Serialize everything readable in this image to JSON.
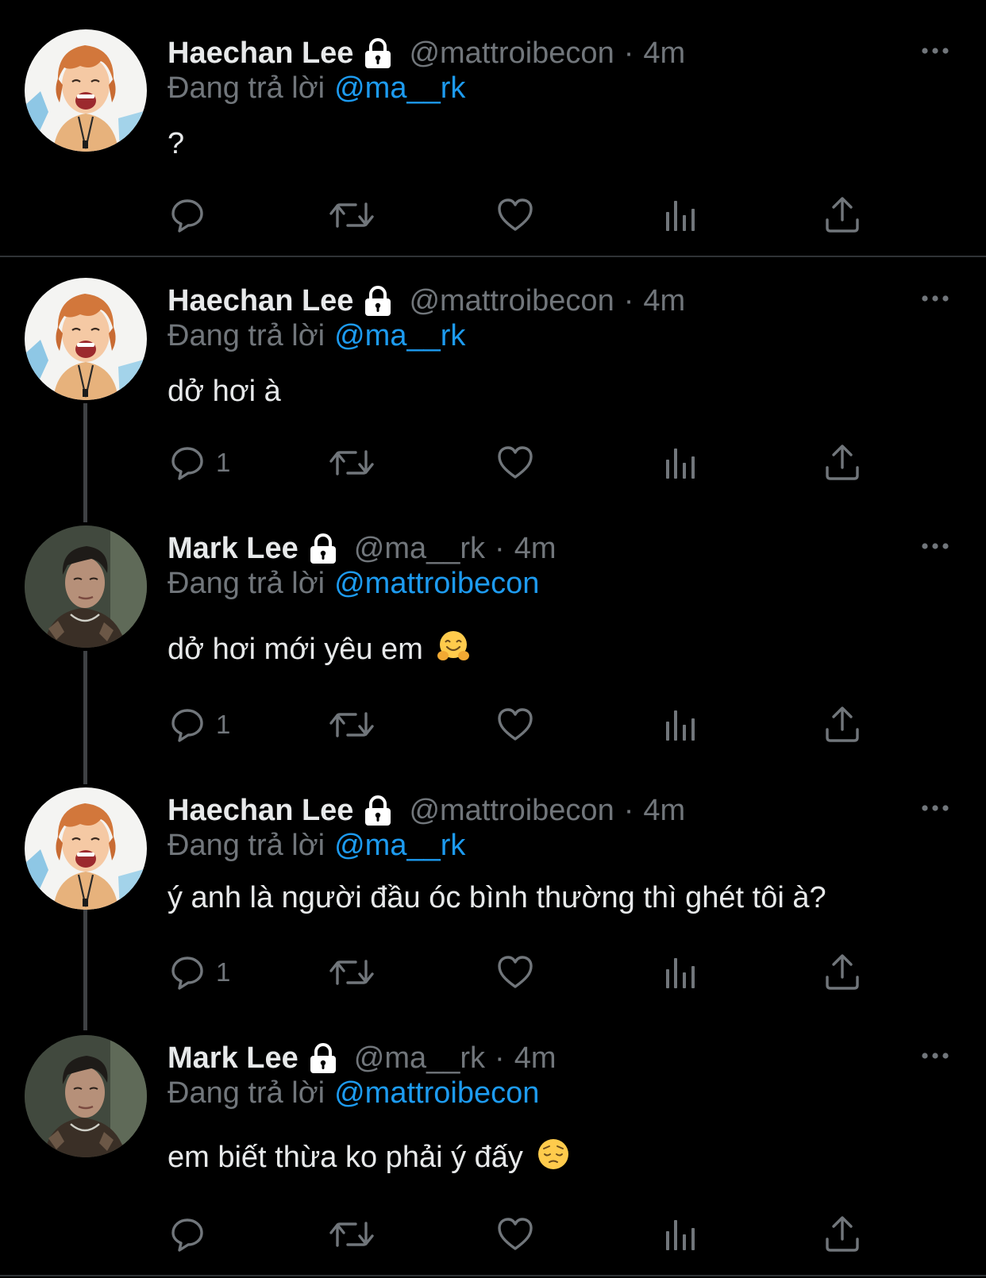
{
  "colors": {
    "background": "#000000",
    "text_primary": "#e7e9ea",
    "text_secondary": "#71767b",
    "mention": "#1d9bf0",
    "thread_line": "#3e4144",
    "divider": "#2f3336"
  },
  "reply_prefix": "Đang trả lời",
  "tweets": [
    {
      "name": "Haechan Lee",
      "handle": "@mattroibecon",
      "separator": "·",
      "time": "4m",
      "reply_to": "@ma__rk",
      "text": "?",
      "emoji": "",
      "reply_count": ""
    },
    {
      "name": "Haechan Lee",
      "handle": "@mattroibecon",
      "separator": "·",
      "time": "4m",
      "reply_to": "@ma__rk",
      "text": "dở hơi à",
      "emoji": "",
      "reply_count": "1"
    },
    {
      "name": "Mark Lee",
      "handle": "@ma__rk",
      "separator": "·",
      "time": "4m",
      "reply_to": "@mattroibecon",
      "text": "dở hơi mới yêu em",
      "emoji": "hugging-face-emoji",
      "reply_count": "1"
    },
    {
      "name": "Haechan Lee",
      "handle": "@mattroibecon",
      "separator": "·",
      "time": "4m",
      "reply_to": "@ma__rk",
      "text": "ý anh là người đầu óc bình thường thì ghét tôi à?",
      "emoji": "",
      "reply_count": "1"
    },
    {
      "name": "Mark Lee",
      "handle": "@ma__rk",
      "separator": "·",
      "time": "4m",
      "reply_to": "@mattroibecon",
      "text": "em biết thừa ko phải ý đấy",
      "emoji": "pensive-face-emoji",
      "reply_count": ""
    }
  ],
  "icons": {
    "protected": "lock-icon",
    "more": "more-horizontal-icon",
    "reply": "reply-bubble-icon",
    "retweet": "retweet-icon",
    "like": "heart-icon",
    "analytics": "analytics-bars-icon",
    "share": "share-upload-icon"
  }
}
